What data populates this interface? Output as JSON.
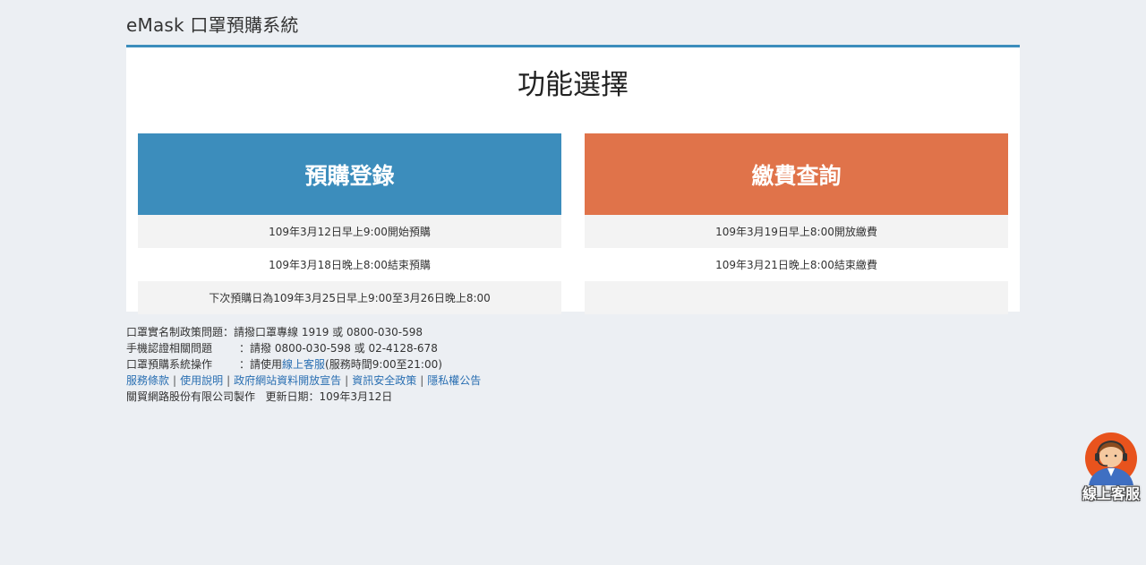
{
  "site": {
    "title": "eMask 口罩預購系統"
  },
  "panel": {
    "heading": "功能選擇"
  },
  "cards": [
    {
      "label": "預購登錄",
      "color": "#3c8dbc",
      "rows": [
        "109年3月12日早上9:00開始預購",
        "109年3月18日晚上8:00結束預購",
        "下次預購日為109年3月25日早上9:00至3月26日晚上8:00"
      ]
    },
    {
      "label": "繳費查詢",
      "color": "#e0734a",
      "rows": [
        "109年3月19日早上8:00開放繳費",
        "109年3月21日晚上8:00結束繳費",
        ""
      ]
    }
  ],
  "footer": {
    "policy_label": "口罩實名制政策問題",
    "policy_text": "：請撥口罩專線 1919 或 0800-030-598",
    "phone_label": "手機認證相關問題",
    "phone_text": "：請撥 0800-030-598 或 02-4128-678",
    "system_label": "口罩預購系統操作",
    "system_prefix": "：請使用",
    "system_link": "線上客服",
    "system_suffix": "(服務時間9:00至21:00)",
    "links": [
      "服務條款",
      "使用說明",
      "政府網站資料開放宣告",
      "資訊安全政策",
      "隱私權公告"
    ],
    "separator": "|",
    "maker": "關貿網路股份有限公司製作",
    "updated": "更新日期：109年3月12日"
  },
  "support": {
    "label": "線上客服",
    "icon": "customer-service-agent-icon",
    "colors": {
      "ring": "#e8531d",
      "face": "#f5c9a0",
      "hair": "#8a4b1f",
      "shirt": "#3f6fc2"
    }
  }
}
